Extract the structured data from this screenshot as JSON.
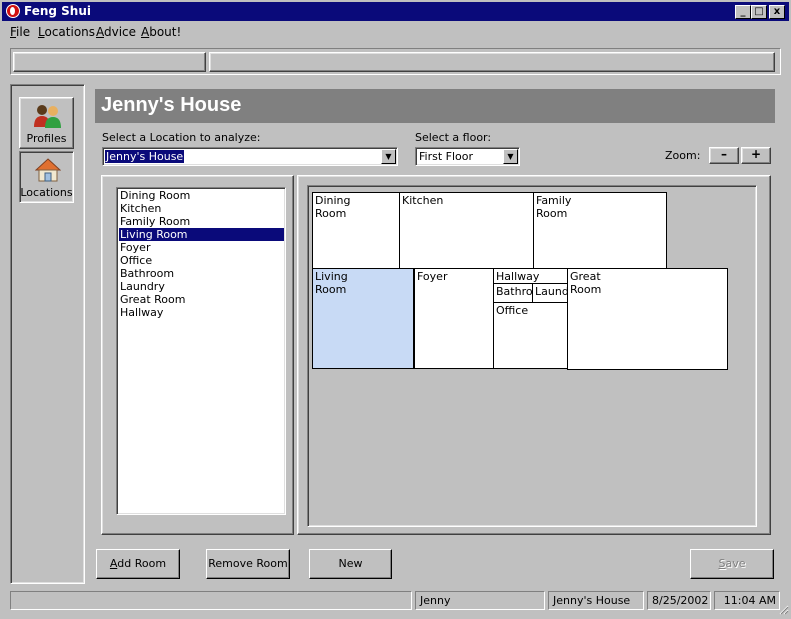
{
  "window": {
    "title": "Feng Shui",
    "controls": [
      "_",
      "□",
      "x"
    ]
  },
  "menu": [
    {
      "mnemonic": "F",
      "rest": "ile"
    },
    {
      "mnemonic": "L",
      "rest": "ocations"
    },
    {
      "mnemonic": "A",
      "rest": "dvice"
    },
    {
      "mnemonic": "A",
      "rest": "bout!"
    }
  ],
  "nav": {
    "profiles_label": "Profiles",
    "locations_label": "Locations",
    "profiles_icon": "people-icon",
    "locations_icon": "house-icon",
    "selected": "Locations"
  },
  "header": {
    "title": "Jenny's House"
  },
  "location_select": {
    "label": "Select a Location to analyze:",
    "value": "Jenny's House"
  },
  "floor_select": {
    "label": "Select a floor:",
    "value": "First Floor"
  },
  "zoom": {
    "label": "Zoom:",
    "out": "–",
    "in": "+"
  },
  "room_list": {
    "items": [
      "Dining Room",
      "Kitchen",
      "Family Room",
      "Living Room",
      "Foyer",
      "Office",
      "Bathroom",
      "Laundry",
      "Great Room",
      "Hallway"
    ],
    "selected": "Living Room"
  },
  "floor_plan": {
    "rooms": [
      {
        "name": "Dining\nRoom"
      },
      {
        "name": "Kitchen"
      },
      {
        "name": "Family\nRoom"
      },
      {
        "name": "Living\nRoom",
        "selected": true
      },
      {
        "name": "Foyer"
      },
      {
        "name": "Hallway"
      },
      {
        "name": "Bathroo"
      },
      {
        "name": "Laundr"
      },
      {
        "name": "Office"
      },
      {
        "name": "Great\nRoom"
      }
    ]
  },
  "buttons": {
    "add": {
      "mnemonic": "A",
      "rest": "dd Room"
    },
    "remove": "Remove Room",
    "new": "New",
    "save": {
      "mnemonic": "S",
      "rest": "ave",
      "enabled": false
    }
  },
  "status": {
    "blank": "",
    "user": "Jenny",
    "location": "Jenny's House",
    "date": "8/25/2002",
    "time": "11:04 AM"
  },
  "colors": {
    "title_bar": "#0a0a7a",
    "header": "#808080",
    "selection": "#0a0a7a",
    "selected_room": "#c8daf5",
    "face": "#c0c0c0"
  }
}
